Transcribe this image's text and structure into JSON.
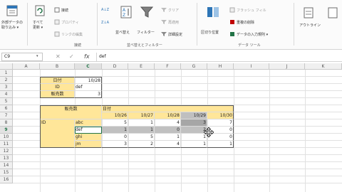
{
  "ribbon": {
    "groups": [
      {
        "name": "get-data",
        "lines": [
          "外部データの",
          "取り込み ▾"
        ]
      },
      {
        "name": "refresh-all",
        "lines": [
          "すべて",
          "更新 ▾"
        ]
      },
      {
        "name": "connections",
        "label": "接続"
      },
      {
        "name": "properties",
        "label": "プロパティ"
      },
      {
        "name": "edit-links",
        "label": "リンクの編集"
      },
      {
        "name": "sort-asc",
        "label": "A↓Z"
      },
      {
        "name": "sort-desc",
        "label": "Z↓A"
      },
      {
        "name": "sort",
        "label": "並べ替え"
      },
      {
        "name": "filter",
        "label": "フィルター"
      },
      {
        "name": "clear",
        "label": "クリア"
      },
      {
        "name": "reapply",
        "label": "再適用"
      },
      {
        "name": "advanced",
        "label": "詳細設定"
      },
      {
        "name": "text-to-columns",
        "label": "区切り位置"
      },
      {
        "name": "flash-fill",
        "label": "フラッシュ フィル"
      },
      {
        "name": "remove-duplicates",
        "label": "重複の削除"
      },
      {
        "name": "data-validation",
        "label": "データの入力規則 ▾"
      },
      {
        "name": "outline",
        "label": "アウトライン"
      }
    ],
    "group_labels": {
      "connections": "接続",
      "sort_filter": "並べ替えとフィルター",
      "data_tools": "データ ツール"
    }
  },
  "formula_bar": {
    "name_box": "C9",
    "dropdown": "▾",
    "cancel": "✕",
    "enter": "✓",
    "fx": "fx",
    "content": "def"
  },
  "columns": [
    "A",
    "B",
    "C",
    "D",
    "E",
    "F",
    "G",
    "H",
    "I",
    "J",
    "K"
  ],
  "rows": [
    "1",
    "2",
    "3",
    "4",
    "5",
    "6",
    "7",
    "8",
    "9",
    "10",
    "11",
    "12",
    "13",
    "14",
    "15",
    "16"
  ],
  "criteria": [
    {
      "label": "日付",
      "value": "10/28"
    },
    {
      "label": "ID",
      "value": "def"
    },
    {
      "label": "販売数",
      "value": "3"
    }
  ],
  "pivot": {
    "corner": "販売数",
    "date_header": "日付",
    "id_header": "ID",
    "dates": [
      "10/26",
      "10/27",
      "10/28",
      "10/29",
      "10/30"
    ],
    "rows": [
      {
        "id": "abc",
        "values": [
          "5",
          "1",
          "4",
          "3",
          "7"
        ]
      },
      {
        "id": "def",
        "values": [
          "1",
          "1",
          "0",
          "2",
          "0"
        ]
      },
      {
        "id": "ghi",
        "values": [
          "0",
          "5",
          "1",
          "1",
          "0"
        ]
      },
      {
        "id": "jm",
        "values": [
          "3",
          "2",
          "4",
          "1",
          "1"
        ]
      }
    ]
  }
}
